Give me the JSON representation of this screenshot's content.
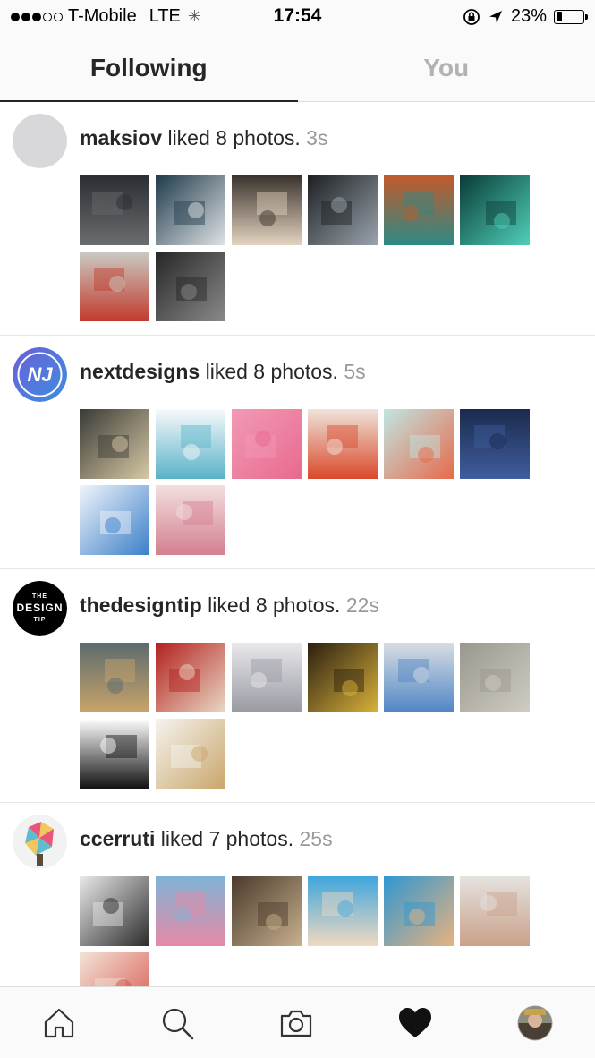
{
  "status_bar": {
    "carrier": "T-Mobile",
    "network": "LTE",
    "time": "17:54",
    "battery": "23%",
    "battery_level": 0.23,
    "signal_bars_full": 3,
    "signal_bars_total": 5
  },
  "tabs": [
    {
      "label": "Following",
      "active": true
    },
    {
      "label": "You",
      "active": false
    }
  ],
  "activities": [
    {
      "user": "maksiov",
      "action": " liked 8 photos. ",
      "time": "3s",
      "avatar": {
        "type": "placeholder",
        "color": "#d8d8da"
      },
      "thumbnails": [
        {
          "name": "chalkboard-lettering-photo",
          "colors": [
            "#2a2e33",
            "#6b6d6e"
          ]
        },
        {
          "name": "chalkboard-typography-photo",
          "colors": [
            "#1f3a4a",
            "#dfe3e6"
          ]
        },
        {
          "name": "mimosas-lettering-photo",
          "colors": [
            "#3a332d",
            "#e4d3c0"
          ]
        },
        {
          "name": "street-wall-photo",
          "colors": [
            "#1c1f22",
            "#9aa4ad"
          ]
        },
        {
          "name": "frida-illustration-photo",
          "colors": [
            "#c25a2c",
            "#2c8a86"
          ]
        },
        {
          "name": "green-character-art-photo",
          "colors": [
            "#0a3b38",
            "#4fd0b8"
          ]
        },
        {
          "name": "red-dragon-chalk-art-photo",
          "colors": [
            "#c9cbc4",
            "#c23a2d"
          ]
        },
        {
          "name": "chalk-sketch-photo",
          "colors": [
            "#262626",
            "#8a8a8a"
          ]
        }
      ]
    },
    {
      "user": "nextdesigns",
      "action": " liked 8 photos. ",
      "time": "5s",
      "avatar": {
        "type": "logo",
        "text": "NJ",
        "colors": [
          "#6b5fd8",
          "#3d8ee0"
        ]
      },
      "thumbnails": [
        {
          "name": "happy-fathers-day-photo",
          "colors": [
            "#3a3a36",
            "#d7c9a5"
          ]
        },
        {
          "name": "diamond-logo-photo",
          "colors": [
            "#f7f9fa",
            "#59b3c9"
          ]
        },
        {
          "name": "pink-isometric-art-photo",
          "colors": [
            "#f29ab5",
            "#e86a8f"
          ]
        },
        {
          "name": "fox-illustration-photo",
          "colors": [
            "#efe4da",
            "#d9482a"
          ]
        },
        {
          "name": "fox-comic-photo",
          "colors": [
            "#bfe6e2",
            "#e76a4b"
          ]
        },
        {
          "name": "fathers-day-card-photo",
          "colors": [
            "#1b2a4e",
            "#3f5e9e"
          ]
        },
        {
          "name": "blue-lettering-photo",
          "colors": [
            "#f1f4fa",
            "#3a7fc9"
          ]
        },
        {
          "name": "floral-letter-photo",
          "colors": [
            "#f2dfdf",
            "#d47f8f"
          ]
        }
      ]
    },
    {
      "user": "thedesigntip",
      "action": " liked 8 photos. ",
      "time": "22s",
      "avatar": {
        "type": "logo",
        "lines": [
          "THE",
          "DESIGN",
          "TIP"
        ],
        "colors": [
          "#000000",
          "#ffffff"
        ]
      },
      "thumbnails": [
        {
          "name": "storefront-photo",
          "colors": [
            "#5c6b6e",
            "#c9a46a"
          ]
        },
        {
          "name": "texas-ranger-sign-photo",
          "colors": [
            "#b3201e",
            "#e9d8c4"
          ]
        },
        {
          "name": "two-thousand-fifteen-type-photo",
          "colors": [
            "#e8e8ec",
            "#9a9aa3"
          ]
        },
        {
          "name": "jetboat-poster-photo",
          "colors": [
            "#2a1f12",
            "#d9b13a"
          ]
        },
        {
          "name": "abc-letters-photo",
          "colors": [
            "#d9dde3",
            "#4f86c4"
          ]
        },
        {
          "name": "arte-stone-photo",
          "colors": [
            "#9a978e",
            "#cfccc3"
          ]
        },
        {
          "name": "font-of-the-week-photo",
          "colors": [
            "#ffffff",
            "#111111"
          ]
        },
        {
          "name": "letter-n-type-photo",
          "colors": [
            "#f5f3ef",
            "#c9a66b"
          ]
        }
      ]
    },
    {
      "user": "ccerruti",
      "action": " liked 7 photos. ",
      "time": "25s",
      "avatar": {
        "type": "art",
        "colors": [
          "#e7456b",
          "#f3c24e",
          "#4fb6c9"
        ]
      },
      "thumbnails": [
        {
          "name": "sketchbook-photo",
          "colors": [
            "#e9e9e9",
            "#2b2b2b"
          ]
        },
        {
          "name": "colorful-houses-photo",
          "colors": [
            "#7fb3d6",
            "#e78aa6"
          ]
        },
        {
          "name": "library-room-photo",
          "colors": [
            "#4b3a2c",
            "#c7b08e"
          ]
        },
        {
          "name": "swimmers-sky-photo",
          "colors": [
            "#3fa6dd",
            "#f0d9c0"
          ]
        },
        {
          "name": "diver-pool-photo",
          "colors": [
            "#2f97d1",
            "#e8b27f"
          ]
        },
        {
          "name": "portrait-busts-photo",
          "colors": [
            "#e5e2df",
            "#c9a189"
          ]
        },
        {
          "name": "faces-illustration-photo",
          "colors": [
            "#f1e3d7",
            "#d9524a"
          ]
        }
      ]
    }
  ],
  "bottom_nav": [
    {
      "name": "home-icon",
      "active": false
    },
    {
      "name": "search-icon",
      "active": false
    },
    {
      "name": "camera-icon",
      "active": false
    },
    {
      "name": "heart-icon",
      "active": true
    },
    {
      "name": "profile-avatar",
      "active": false
    }
  ]
}
